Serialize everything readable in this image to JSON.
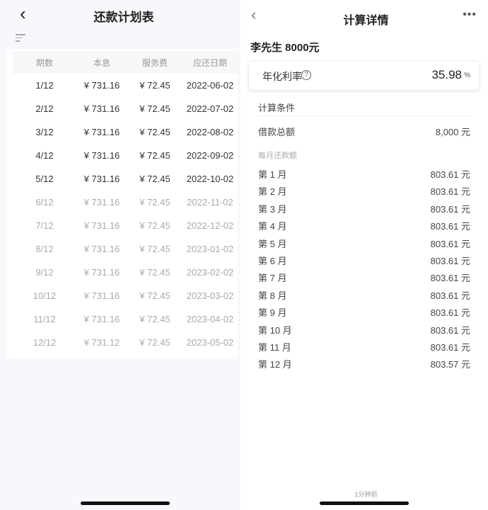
{
  "left": {
    "title": "还款计划表",
    "headers": [
      "期数",
      "本息",
      "服务费",
      "应还日期"
    ],
    "rows": [
      [
        "1/12",
        "¥ 731.16",
        "¥ 72.45",
        "2022-06-02"
      ],
      [
        "2/12",
        "¥ 731.16",
        "¥ 72.45",
        "2022-07-02"
      ],
      [
        "3/12",
        "¥ 731.16",
        "¥ 72.45",
        "2022-08-02"
      ],
      [
        "4/12",
        "¥ 731.16",
        "¥ 72.45",
        "2022-09-02"
      ],
      [
        "5/12",
        "¥ 731.16",
        "¥ 72.45",
        "2022-10-02"
      ],
      [
        "6/12",
        "¥ 731.16",
        "¥ 72.45",
        "2022-11-02"
      ],
      [
        "7/12",
        "¥ 731.16",
        "¥ 72.45",
        "2022-12-02"
      ],
      [
        "8/12",
        "¥ 731.16",
        "¥ 72.45",
        "2023-01-02"
      ],
      [
        "9/12",
        "¥ 731.16",
        "¥ 72.45",
        "2023-02-02"
      ],
      [
        "10/12",
        "¥ 731.16",
        "¥ 72.45",
        "2023-03-02"
      ],
      [
        "11/12",
        "¥ 731.16",
        "¥ 72.45",
        "2023-04-02"
      ],
      [
        "12/12",
        "¥ 731.12",
        "¥ 72.45",
        "2023-05-02"
      ]
    ],
    "paid_count": 5
  },
  "right": {
    "title": "计算详情",
    "name": "李先生 8000元",
    "rate_label": "年化利率",
    "rate_value": "35.98",
    "rate_unit": "%",
    "conditions_label": "计算条件",
    "loan_label": "借款总额",
    "loan_value": "8,000 元",
    "monthly_label": "每月还款额",
    "months": [
      [
        "第 1 月",
        "803.61 元"
      ],
      [
        "第 2 月",
        "803.61 元"
      ],
      [
        "第 3 月",
        "803.61 元"
      ],
      [
        "第 4 月",
        "803.61 元"
      ],
      [
        "第 5 月",
        "803.61 元"
      ],
      [
        "第 6 月",
        "803.61 元"
      ],
      [
        "第 7 月",
        "803.61 元"
      ],
      [
        "第 8 月",
        "803.61 元"
      ],
      [
        "第 9 月",
        "803.61 元"
      ],
      [
        "第 10 月",
        "803.61 元"
      ],
      [
        "第 11 月",
        "803.61 元"
      ],
      [
        "第 12 月",
        "803.57 元"
      ]
    ],
    "footer": "1分钟前"
  }
}
